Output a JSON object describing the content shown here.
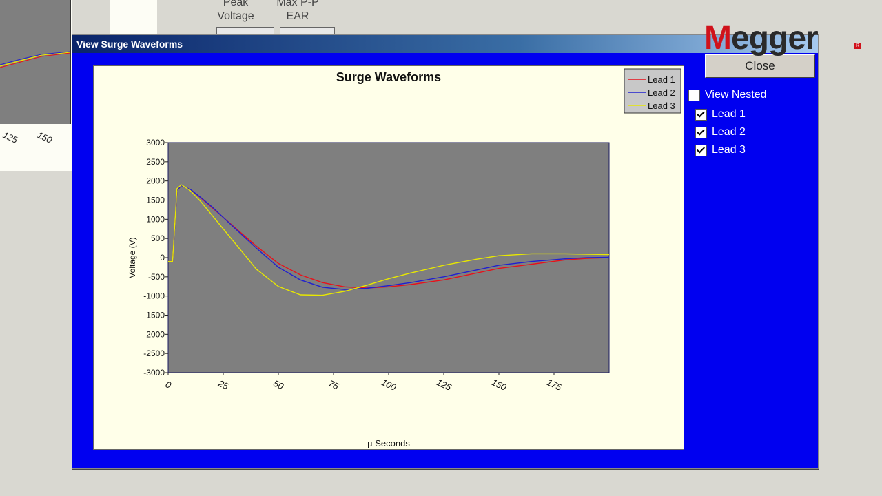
{
  "background_app": {
    "col1_header": [
      "Peak",
      "Voltage"
    ],
    "col2_header": [
      "Max P-P",
      "EAR"
    ],
    "ticks": [
      "125",
      "150"
    ]
  },
  "logo": {
    "text_first": "M",
    "text_rest": "egger",
    "mark": "R"
  },
  "dialog": {
    "title": "View Surge Waveforms",
    "close_label": "Close",
    "view_nested_label": "View Nested",
    "view_nested_checked": false,
    "leads": [
      {
        "label": "Lead 1",
        "checked": true
      },
      {
        "label": "Lead 2",
        "checked": true
      },
      {
        "label": "Lead 3",
        "checked": true
      }
    ]
  },
  "colors": {
    "lead1": "#e8111a",
    "lead2": "#2020d0",
    "lead3": "#e8e800",
    "plot_bg": "#7f7f7f",
    "dialog_bg": "#0000f0"
  },
  "chart_data": {
    "type": "line",
    "title": "Surge Waveforms",
    "xlabel": "µ Seconds",
    "ylabel": "Voltage (V)",
    "xlim": [
      0,
      200
    ],
    "ylim": [
      -3000,
      3000
    ],
    "xticks": [
      0,
      25,
      50,
      75,
      100,
      125,
      150,
      175
    ],
    "yticks": [
      3000,
      2500,
      2000,
      1500,
      1000,
      500,
      0,
      -500,
      -1000,
      -1500,
      -2000,
      -2500,
      -3000
    ],
    "legend_position": "top-right",
    "series": [
      {
        "name": "Lead 1",
        "x": [
          0,
          2,
          4,
          6,
          10,
          15,
          20,
          25,
          30,
          40,
          50,
          60,
          70,
          80,
          90,
          100,
          110,
          125,
          140,
          150,
          165,
          180,
          190,
          200
        ],
        "y": [
          -100,
          -100,
          1750,
          1880,
          1780,
          1550,
          1300,
          1050,
          800,
          300,
          -150,
          -450,
          -650,
          -760,
          -790,
          -760,
          -700,
          -580,
          -400,
          -280,
          -170,
          -60,
          -20,
          0
        ]
      },
      {
        "name": "Lead 2",
        "x": [
          0,
          2,
          4,
          6,
          10,
          15,
          20,
          25,
          30,
          40,
          50,
          60,
          70,
          80,
          90,
          100,
          110,
          125,
          140,
          150,
          165,
          180,
          190,
          200
        ],
        "y": [
          -100,
          -100,
          1750,
          1880,
          1780,
          1560,
          1320,
          1050,
          780,
          250,
          -250,
          -580,
          -770,
          -830,
          -800,
          -730,
          -650,
          -500,
          -320,
          -200,
          -100,
          -30,
          0,
          10
        ]
      },
      {
        "name": "Lead 3",
        "x": [
          0,
          2,
          4,
          6,
          10,
          15,
          20,
          25,
          30,
          40,
          50,
          60,
          70,
          80,
          90,
          100,
          110,
          125,
          140,
          150,
          165,
          180,
          190,
          200
        ],
        "y": [
          -100,
          -100,
          1800,
          1900,
          1750,
          1450,
          1100,
          750,
          400,
          -300,
          -750,
          -970,
          -980,
          -880,
          -720,
          -550,
          -400,
          -200,
          -40,
          50,
          100,
          100,
          90,
          80
        ]
      }
    ]
  }
}
